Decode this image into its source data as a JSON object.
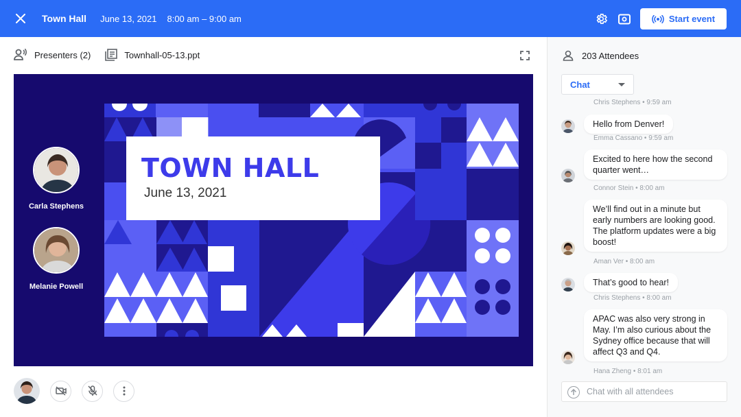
{
  "header": {
    "title": "Town Hall",
    "date": "June 13, 2021",
    "time": "8:00 am – 9:00 am",
    "start_label": "Start event",
    "icons": [
      "close-icon",
      "settings-icon",
      "cast-icon",
      "broadcast-icon"
    ]
  },
  "toolbar": {
    "presenters_label": "Presenters (2)",
    "file_label": "Townhall-05-13.ppt"
  },
  "presenters": [
    {
      "name": "Carla Stephens"
    },
    {
      "name": "Melanie Powell"
    }
  ],
  "slide": {
    "title": "TOWN HALL",
    "subtitle": "June 13, 2021"
  },
  "side": {
    "attendees_label": "203 Attendees",
    "chat_select": "Chat",
    "input_placeholder": "Chat with all attendees"
  },
  "messages": [
    {
      "text": "",
      "meta": "Chris Stephens • 9:59 am"
    },
    {
      "text": "Hello from Denver!",
      "meta": "Emma Cassano • 9:59 am"
    },
    {
      "text": "Excited to here how the second quarter went…",
      "meta": "Connor Stein • 8:00 am"
    },
    {
      "text": "We’ll find out in a minute but early numbers are looking good. The platform updates were a big boost!",
      "meta": "Aman Ver • 8:00 am"
    },
    {
      "text": "That’s good to hear!",
      "meta": "Chris Stephens • 8:00 am"
    },
    {
      "text": "APAC was also very strong in May. I’m also curious about the Sydney office because that will affect Q3 and Q4.",
      "meta": "Hana Zheng • 8:01 am"
    }
  ],
  "colors": {
    "accent": "#2b6cf6",
    "stage": "#160a6e",
    "slide_blue": "#4a4ff0",
    "slide_title": "#3d3bea"
  }
}
